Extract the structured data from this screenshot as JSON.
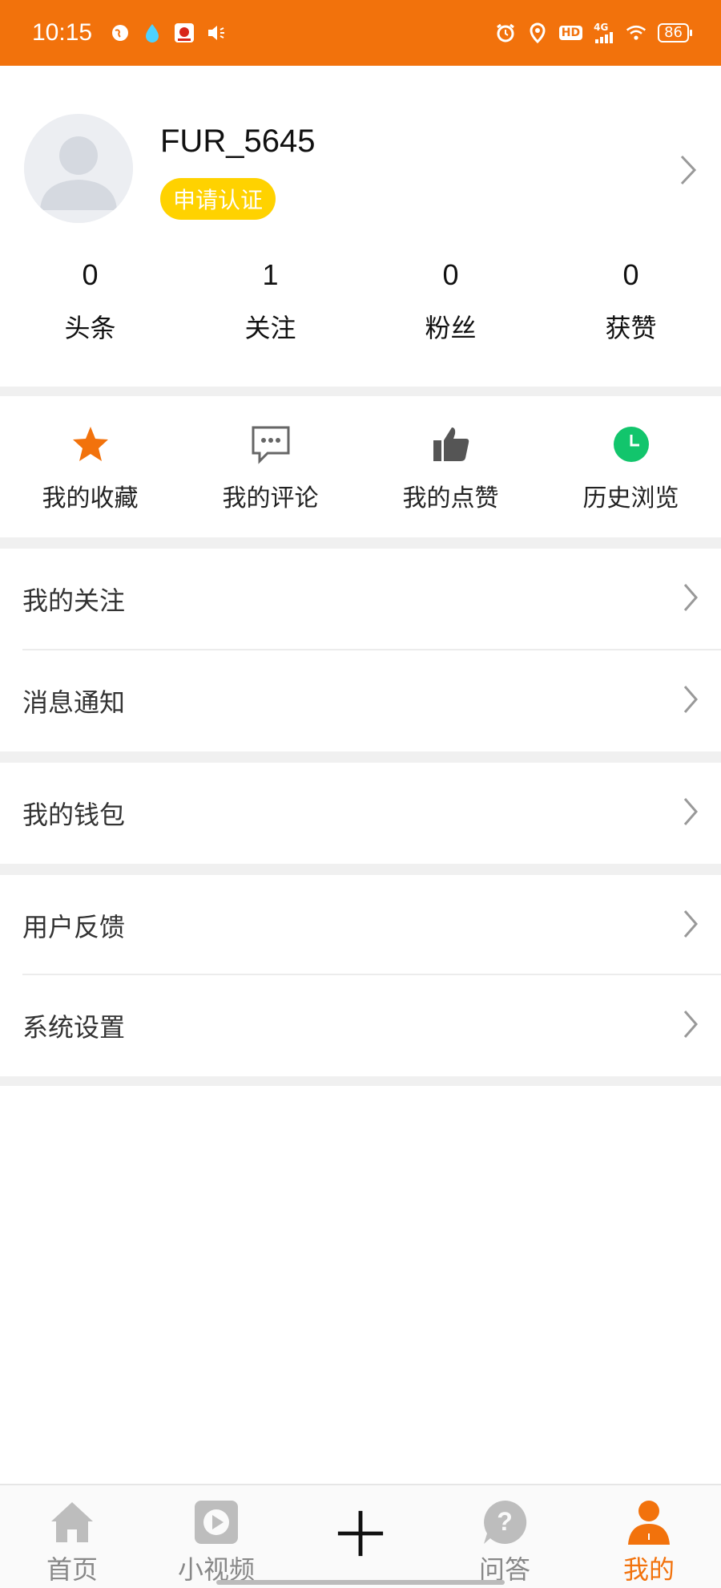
{
  "status_bar": {
    "time": "10:15",
    "network": "4G",
    "hd": "HD",
    "battery": "86",
    "accent_color": "#f2720c"
  },
  "profile": {
    "username": "FUR_5645",
    "verify_label": "申请认证",
    "stats": [
      {
        "value": "0",
        "label": "头条"
      },
      {
        "value": "1",
        "label": "关注"
      },
      {
        "value": "0",
        "label": "粉丝"
      },
      {
        "value": "0",
        "label": "获赞"
      }
    ]
  },
  "quick_actions": [
    {
      "label": "我的收藏",
      "icon": "star-icon",
      "color": "#f2720c"
    },
    {
      "label": "我的评论",
      "icon": "comment-icon",
      "color": "#666666"
    },
    {
      "label": "我的点赞",
      "icon": "thumbs-up-icon",
      "color": "#555555"
    },
    {
      "label": "历史浏览",
      "icon": "clock-icon",
      "color": "#12c56c"
    }
  ],
  "menu": [
    {
      "label": "我的关注"
    },
    {
      "label": "消息通知"
    },
    {
      "label": "我的钱包"
    },
    {
      "label": "用户反馈"
    },
    {
      "label": "系统设置"
    }
  ],
  "bottom_nav": [
    {
      "label": "首页",
      "icon": "home-icon"
    },
    {
      "label": "小视频",
      "icon": "video-icon"
    },
    {
      "label": "",
      "icon": "plus-icon"
    },
    {
      "label": "问答",
      "icon": "question-icon"
    },
    {
      "label": "我的",
      "icon": "person-icon",
      "active": true
    }
  ]
}
